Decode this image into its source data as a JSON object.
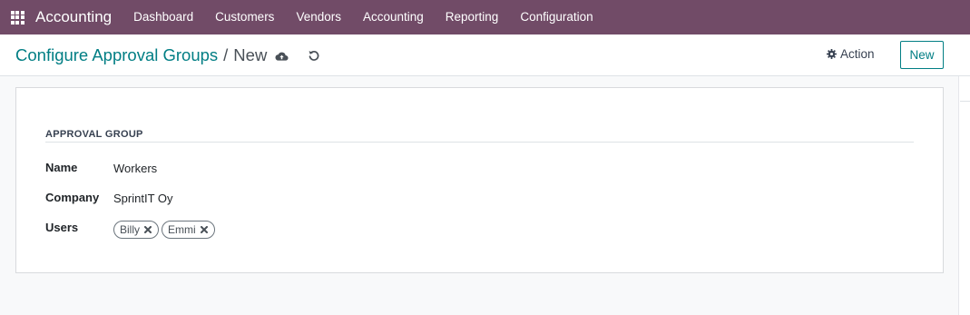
{
  "navbar": {
    "app_icon": "apps-grid-icon",
    "brand": "Accounting",
    "menu": [
      "Dashboard",
      "Customers",
      "Vendors",
      "Accounting",
      "Reporting",
      "Configuration"
    ]
  },
  "control_panel": {
    "breadcrumb_parent": "Configure Approval Groups",
    "breadcrumb_separator": "/",
    "breadcrumb_current": "New",
    "save_icon": "cloud-upload-icon",
    "discard_icon": "undo-icon",
    "action_label": "Action",
    "action_icon": "gear-icon",
    "new_button": "New"
  },
  "form": {
    "group_title": "APPROVAL GROUP",
    "fields": {
      "name": {
        "label": "Name",
        "value": "Workers"
      },
      "company": {
        "label": "Company",
        "value": "SprintIT Oy"
      },
      "users": {
        "label": "Users",
        "tags": [
          "Billy",
          "Emmi"
        ]
      }
    }
  },
  "colors": {
    "navbar_bg": "#714b67",
    "accent": "#017e84"
  }
}
